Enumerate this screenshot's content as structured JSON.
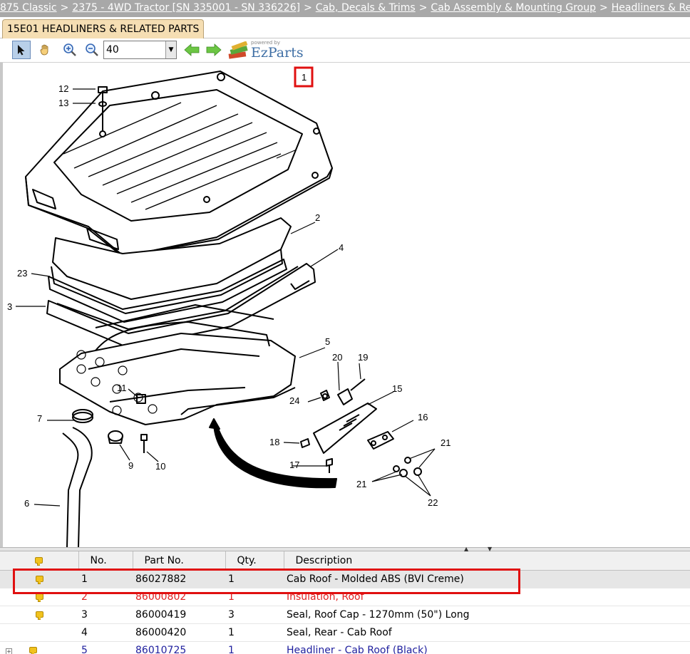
{
  "breadcrumb": [
    {
      "label": "875 Classic"
    },
    {
      "label": "2375 - 4WD Tractor [SN 335001 - SN 336226]"
    },
    {
      "label": "Cab, Decals & Trims"
    },
    {
      "label": "Cab Assembly & Mounting Group"
    },
    {
      "label": "Headliners & Related Parts"
    }
  ],
  "breadcrumb_separator": ">",
  "tab": {
    "label": "15E01 HEADLINERS & RELATED PARTS"
  },
  "toolbar": {
    "zoom_value": "40",
    "tools": [
      "select-arrow-icon",
      "pan-hand-icon",
      "zoom-in-icon",
      "zoom-out-icon",
      "back-arrow-icon",
      "forward-arrow-icon"
    ],
    "brand_powered": "powered by",
    "brand_name": "EzParts"
  },
  "diagram": {
    "callouts": [
      "1",
      "2",
      "3",
      "4",
      "5",
      "6",
      "7",
      "9",
      "10",
      "11",
      "12",
      "13",
      "15",
      "16",
      "17",
      "18",
      "19",
      "20",
      "21",
      "21",
      "22",
      "23",
      "24"
    ],
    "highlighted_callout": "1"
  },
  "table": {
    "columns": [
      "No.",
      "Part No.",
      "Qty.",
      "Description"
    ],
    "rows": [
      {
        "no": "1",
        "part": "86027882",
        "qty": "1",
        "desc": "Cab Roof - Molded ABS (BVI Creme)",
        "note": true,
        "style": "sel"
      },
      {
        "no": "2",
        "part": "86000802",
        "qty": "1",
        "desc": "Insulation, Roof",
        "note": true,
        "style": "red"
      },
      {
        "no": "3",
        "part": "86000419",
        "qty": "3",
        "desc": "Seal, Roof Cap - 1270mm (50\") Long",
        "note": true,
        "style": "normal"
      },
      {
        "no": "4",
        "part": "86000420",
        "qty": "1",
        "desc": "Seal, Rear - Cab Roof",
        "note": false,
        "style": "normal"
      },
      {
        "no": "5",
        "part": "86010725",
        "qty": "1",
        "desc": "Headliner - Cab Roof (Black)",
        "note": true,
        "style": "blue",
        "expander": "+"
      }
    ]
  },
  "colors": {
    "highlight": "#e01010",
    "tab": "#f5deb3",
    "breadcrumb_bg": "#a8a8a8"
  }
}
